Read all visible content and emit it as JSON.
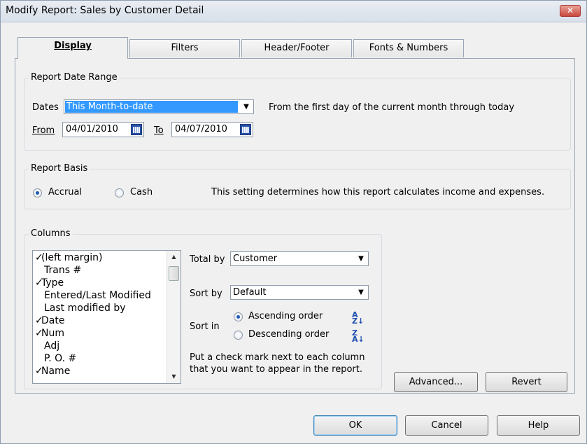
{
  "window": {
    "title": "Modify Report: Sales by Customer Detail",
    "close_glyph": "✕"
  },
  "tabs": [
    {
      "label": "Display"
    },
    {
      "label": "Filters"
    },
    {
      "label": "Header/Footer"
    },
    {
      "label": "Fonts & Numbers"
    }
  ],
  "date_range": {
    "group_label": "Report Date Range",
    "dates_label": "Dates",
    "dates_value": "This Month-to-date",
    "description": "From the first day of the current month through today",
    "from_label": "From",
    "from_value": "04/01/2010",
    "to_label": "To",
    "to_value": "04/07/2010"
  },
  "basis": {
    "group_label": "Report Basis",
    "accrual_label": "Accrual",
    "cash_label": "Cash",
    "selected": "Accrual",
    "description": "This setting determines how this report calculates income and expenses."
  },
  "columns": {
    "group_label": "Columns",
    "items": [
      {
        "label": "(left margin)",
        "checked": true,
        "mark": "✓"
      },
      {
        "label": "Trans #",
        "checked": false,
        "mark": ""
      },
      {
        "label": "Type",
        "checked": true,
        "mark": "✓"
      },
      {
        "label": "Entered/Last Modified",
        "checked": false,
        "mark": ""
      },
      {
        "label": "Last modified by",
        "checked": false,
        "mark": ""
      },
      {
        "label": "Date",
        "checked": true,
        "mark": "✓"
      },
      {
        "label": "Num",
        "checked": true,
        "mark": "✓"
      },
      {
        "label": "Adj",
        "checked": false,
        "mark": ""
      },
      {
        "label": "P. O. #",
        "checked": false,
        "mark": ""
      },
      {
        "label": "Name",
        "checked": true,
        "mark": "✓"
      }
    ],
    "total_by_label": "Total by",
    "total_by_value": "Customer",
    "sort_by_label": "Sort by",
    "sort_by_value": "Default",
    "sort_in_label": "Sort in",
    "ascending_label": "Ascending order",
    "descending_label": "Descending order",
    "sort_selected": "Ascending order",
    "hint_line1": "Put a check mark next to each column",
    "hint_line2": "that you want to appear in the report."
  },
  "buttons": {
    "advanced": "Advanced...",
    "revert": "Revert",
    "ok": "OK",
    "cancel": "Cancel",
    "help": "Help"
  }
}
